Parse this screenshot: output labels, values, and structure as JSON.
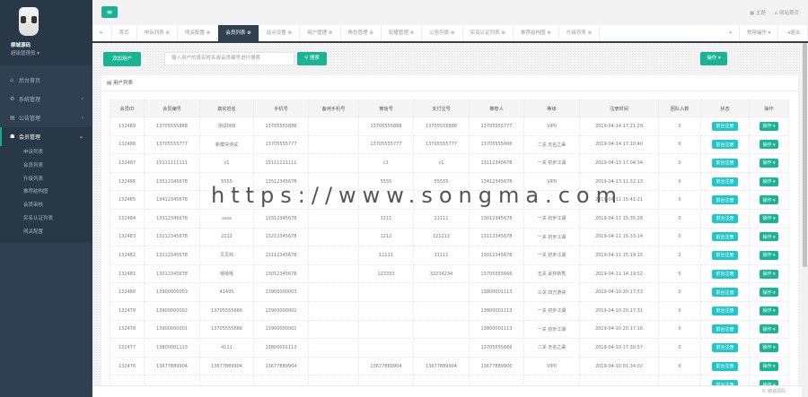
{
  "sidebar": {
    "username": "柳城源码",
    "role": "超级管理员 ▾",
    "items": [
      {
        "label": "后台首页",
        "icon": "home"
      },
      {
        "label": "系统管理",
        "icon": "gear"
      },
      {
        "label": "公告管理",
        "icon": "notice"
      },
      {
        "label": "会员管理",
        "icon": "user"
      }
    ],
    "subitems": [
      "申诉列表",
      "会员列表",
      "升级列表",
      "推荐结构图",
      "会员审核",
      "实名认证列表",
      "闯关配置"
    ]
  },
  "topbar": {
    "theme": "主题",
    "site_home": "网站首页"
  },
  "tabs": [
    "首页",
    "申诉列表",
    "闯关配置",
    "会员列表",
    "站点设置",
    "用户管理",
    "角色管理",
    "轮播管理",
    "公告列表",
    "实名认证列表",
    "推荐结构图",
    "升级列表"
  ],
  "tabs_right": {
    "common_ops": "常用操作 ▾",
    "logout": "退出"
  },
  "toolbar": {
    "add_user": "添加用户",
    "search_placeholder": "输入用户的真实姓名或会员编号进行搜索",
    "search_btn": "搜索",
    "ops": "操作 ▾"
  },
  "panel_title": "用户列表",
  "columns": [
    "会员ID",
    "会员编号",
    "真实姓名",
    "手机号",
    "备用手机号",
    "微信号",
    "支付宝号",
    "推荐人",
    "等级",
    "注册时间",
    "团队人数",
    "状态",
    "操作"
  ],
  "status_label": "前台注册",
  "op_label": "操作 ▾",
  "rows": [
    [
      "132489",
      "13705555888",
      "测试008",
      "13705555888",
      "",
      "13705555888",
      "13705555888",
      "13705555777",
      "VIP0",
      "2019-04-14 17:21:29",
      "0"
    ],
    [
      "132488",
      "13705555777",
      "新模块测试",
      "13705555777",
      "",
      "13705555777",
      "13705555777",
      "13705555666",
      "二关 无名之辈",
      "2019-04-14 17:10:40",
      "0"
    ],
    [
      "132487",
      "15111111111",
      "c1",
      "15111111111",
      "",
      "c1",
      "c1",
      "13112345678",
      "一关 初步江湖",
      "2019-04-13 17:04:34",
      "0"
    ],
    [
      "132486",
      "13512345678",
      "5555",
      "13512345678",
      "",
      "5555",
      "55555",
      "13412345678",
      "VIP0",
      "2019-04-13 11:32:13",
      "0"
    ],
    [
      "132485",
      "13412345678",
      "",
      "",
      "",
      "",
      "",
      "",
      "",
      "2019-04-11 15:41:21",
      "0"
    ],
    [
      "132484",
      "13312345678",
      "ssss",
      "13312345678",
      "",
      "1111",
      "11111",
      "13012345678",
      "一关 初步江湖",
      "2019-04-11 15:35:28",
      "0"
    ],
    [
      "132483",
      "13212345678",
      "2222",
      "13212345678",
      "",
      "1212",
      "121212",
      "13112345678",
      "一关 初步江湖",
      "2019-04-11 15:33:14",
      "0"
    ],
    [
      "132482",
      "13112345678",
      "贝贝鸡",
      "13112345678",
      "",
      "11111",
      "11111",
      "13012345678",
      "一关 初步江湖",
      "2019-04-11 15:19:15",
      "2"
    ],
    [
      "132481",
      "13012345678",
      "嘻嘻嘻",
      "13012345678",
      "",
      "123333",
      "32234234",
      "13705555666",
      "五关 武林新秀",
      "2019-04-11 14:19:52",
      "5"
    ],
    [
      "132480",
      "13900000003",
      "41495",
      "13900000003",
      "",
      "",
      "",
      "13800001113",
      "三关 四方游侠",
      "2019-04-10 20:17:53",
      "0"
    ],
    [
      "132479",
      "13900000002",
      "13705555666",
      "13900000002",
      "",
      "",
      "",
      "13800001113",
      "一关 初步江湖",
      "2019-04-10 20:17:31",
      "0"
    ],
    [
      "132478",
      "13900000001",
      "13705555666",
      "13900000001",
      "",
      "",
      "",
      "13800001113",
      "一关 初步江湖",
      "2019-04-10 20:17:16",
      "0"
    ],
    [
      "132477",
      "13800001113",
      "4111",
      "13800001113",
      "",
      "",
      "",
      "13705555666",
      "二关 无名之辈",
      "2019-04-10 17:30:57",
      "0"
    ],
    [
      "132476",
      "13677889904",
      "13677889904",
      "13677889904",
      "",
      "13677889904",
      "13677889904",
      "13677889900",
      "VIP0",
      "2019-04-10 01:34:02",
      "0"
    ],
    [
      "",
      "",
      "",
      "",
      "",
      "",
      "",
      "",
      "",
      "",
      ""
    ]
  ],
  "watermark": "https://www.songma.com",
  "footer": "© 柳城源码",
  "colors": {
    "sidebar": "#2f4050",
    "accent": "#1ab394",
    "badge": "#23c6c8"
  }
}
